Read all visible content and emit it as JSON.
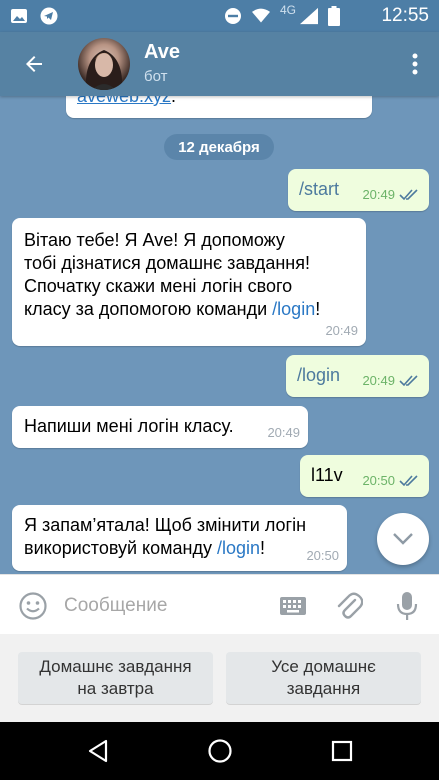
{
  "status_bar": {
    "time": "12:55",
    "network": "4G",
    "icons": [
      "image-icon",
      "telegram-icon",
      "do-not-disturb-icon",
      "wifi-icon",
      "signal-icon",
      "battery-icon"
    ]
  },
  "header": {
    "title": "Ave",
    "subtitle": "бот",
    "back_icon": "arrow-left-icon",
    "menu_icon": "more-vertical-icon"
  },
  "chat": {
    "top_partial_link": "aveweb.xyz",
    "top_partial_punct": ".",
    "date": "12 декабря",
    "messages": [
      {
        "dir": "out",
        "text": "/start",
        "time": "20:49"
      },
      {
        "dir": "in",
        "lines": [
          "Вітаю тебе! Я Ave! Я допоможу",
          "тобі дізнатися домашнє завдання!",
          "Спочатку скажи мені логін свого"
        ],
        "line4_prefix": "класу за допомогою команди ",
        "line4_cmd": "/login",
        "line4_suffix": "!",
        "time": "20:49"
      },
      {
        "dir": "out",
        "text": "/login",
        "time": "20:49"
      },
      {
        "dir": "in",
        "text": "Напиши мені логін класу.",
        "time": "20:49"
      },
      {
        "dir": "out",
        "text": "l11v",
        "time": "20:50"
      },
      {
        "dir": "in",
        "line1": "Я запам’ятала! Щоб змінити логін",
        "line2_prefix": "використовуй команду ",
        "line2_cmd": "/login",
        "line2_suffix": "!",
        "time": "20:50"
      }
    ]
  },
  "composer": {
    "placeholder": "Сообщение"
  },
  "keyboard": {
    "buttons": [
      {
        "line1": "Домашнє завдання",
        "line2": "на завтра"
      },
      {
        "line1": "Усе домашнє",
        "line2": "завдання"
      }
    ]
  },
  "colors": {
    "header": "#5682a3",
    "chat_bg": "#6e96ba",
    "out_bubble": "#effdde",
    "in_bubble": "#ffffff",
    "link": "#2a78c5"
  }
}
